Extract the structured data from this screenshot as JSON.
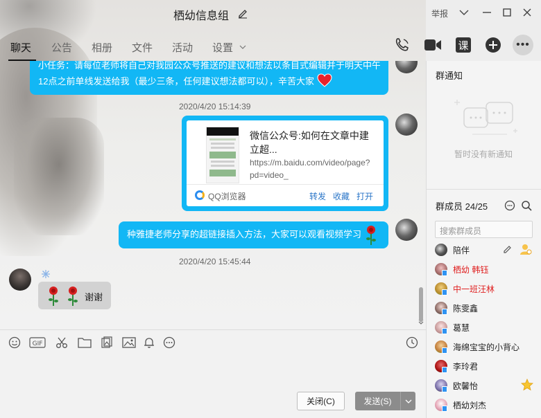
{
  "window": {
    "title": "栖幼信息组",
    "report_label": "举报"
  },
  "tabs": [
    {
      "label": "聊天",
      "active": true
    },
    {
      "label": "公告"
    },
    {
      "label": "相册"
    },
    {
      "label": "文件"
    },
    {
      "label": "活动"
    },
    {
      "label": "设置"
    }
  ],
  "header_icons": [
    "phone-icon",
    "video-icon",
    "class-icon",
    "add-icon",
    "more-icon"
  ],
  "chat": {
    "msg1_line1": "小任务：请每位老师将自己对我园公众号推送的建议和想法以条目式编辑并于明天中午",
    "msg1_line2": "12点之前单线发送给我（最少三条，任何建议想法都可以），辛苦大家",
    "ts1": "2020/4/20 15:14:39",
    "card": {
      "title": "微信公众号:如何在文章中建立超...",
      "url": "https://m.baidu.com/video/page?pd=video_",
      "source": "QQ浏览器",
      "actions": [
        "转发",
        "收藏",
        "打开"
      ]
    },
    "msg3": "种雅捷老师分享的超链接插入方法，大家可以观看视频学习",
    "ts2": "2020/4/20 15:45:44",
    "msg4": "谢谢"
  },
  "toolbar_icons": [
    "emoji-icon",
    "gif-icon",
    "scissors-icon",
    "folder-icon",
    "gallery-icon",
    "image-icon",
    "bell-icon",
    "more-circle-icon",
    "history-icon"
  ],
  "buttons": {
    "close": "关闭(C)",
    "send": "发送(S)"
  },
  "panel": {
    "notice_title": "群通知",
    "notice_empty": "暂时没有新通知",
    "members_title": "群成员 24/25",
    "search_placeholder": "搜索群成员",
    "members": [
      {
        "name": "陪伴",
        "red": false
      },
      {
        "name": "栖幼 韩钰",
        "red": true
      },
      {
        "name": "中一班汪林",
        "red": true
      },
      {
        "name": "陈雯鑫",
        "red": false
      },
      {
        "name": "葛慧",
        "red": false
      },
      {
        "name": "海绵宝宝的小背心",
        "red": false
      },
      {
        "name": "李玲君",
        "red": false
      },
      {
        "name": "欧馨怡",
        "red": false
      },
      {
        "name": "栖幼刘杰",
        "red": false
      }
    ]
  },
  "colors": {
    "bubble_blue": "#12b7f5",
    "red_name": "#e02020",
    "link_blue": "#2b76c8"
  }
}
